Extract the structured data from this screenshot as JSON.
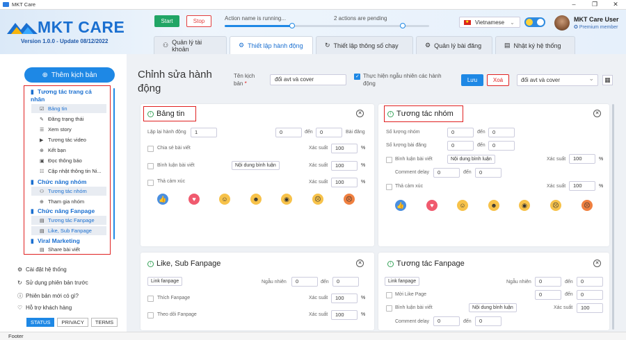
{
  "window": {
    "title": "MKT Care"
  },
  "brand": {
    "name": "MKT CARE",
    "version": "Version 1.0.0 - Update 08/12/2022"
  },
  "controls": {
    "start": "Start",
    "stop": "Stop",
    "action_status": "Action name is running...",
    "pending_status": "2 actions are pending",
    "action_progress": 0.33,
    "pending_progress": 0.72
  },
  "language": {
    "selected": "Vietnamese"
  },
  "user": {
    "name": "MKT Care User",
    "tier": "Premium member"
  },
  "tabs": [
    {
      "label": "Quản lý tài khoản",
      "icon": "user-icon"
    },
    {
      "label": "Thiết lập hành động",
      "icon": "gear-icon"
    },
    {
      "label": "Thiết lập thông số chạy",
      "icon": "refresh-icon"
    },
    {
      "label": "Quản lý bài đăng",
      "icon": "gear-icon"
    },
    {
      "label": "Nhật ký hệ thống",
      "icon": "log-icon"
    }
  ],
  "sidebar": {
    "add_button": "Thêm kịch bản",
    "groups": [
      {
        "label": "Tương tác trang cá",
        "label2": "nhân",
        "items": [
          "Bảng tin",
          "Đăng trạng thái",
          "Xem story",
          "Tương tác video",
          "Kết bạn",
          "Đọc thông báo",
          "Cập nhật thông tin Ni..."
        ]
      },
      {
        "label": "Chức năng nhóm",
        "items": [
          "Tương tác nhóm",
          "Tham gia nhóm"
        ]
      },
      {
        "label": "Chức năng Fanpage",
        "items": [
          "Tương tác Fanpage",
          "Like, Sub Fanpage"
        ]
      },
      {
        "label": "Viral Marketing",
        "items": [
          "Share bài viết"
        ]
      }
    ],
    "links": [
      "Cài đặt hệ thống",
      "Sử dụng phiên bản trước",
      "Phiên bản mới có gì?",
      "Hỗ trợ khách hàng"
    ],
    "footer_buttons": [
      "STATUS",
      "PRIVACY",
      "TERMS"
    ]
  },
  "footer": "Footer",
  "editor": {
    "title": "Chỉnh sửa hành động",
    "name_label": "Tên kịch bản",
    "required": "*",
    "name_value": "đổi avt và cover",
    "random_label": "Thực hiện ngẫu nhiên các hành động",
    "save": "Lưu",
    "delete": "Xoá",
    "select_value": "đổi avt và cover"
  },
  "cards": {
    "bang_tin": {
      "title": "Bảng tin",
      "repeat_label": "Lặp lại hành động",
      "repeat_value": "1",
      "from_value": "0",
      "to_label": "đến",
      "to_value": "0",
      "posts_label": "Bài đăng",
      "rows": [
        {
          "label": "Chia sẻ bài viết",
          "prob_label": "Xác suất",
          "value": "100",
          "unit": "%"
        },
        {
          "label": "Bình luận bài viết",
          "button": "Nội dung bình luận",
          "prob_label": "Xác suất",
          "value": "100",
          "unit": "%"
        },
        {
          "label": "Thả cảm xúc",
          "prob_label": "Xác suất",
          "value": "100",
          "unit": "%"
        }
      ]
    },
    "tuong_tac_nhom": {
      "title": "Tương tác nhóm",
      "groups_label": "Số lượng nhóm",
      "posts_label": "Số lượng bài đăng",
      "to_label": "đến",
      "g_from": "0",
      "g_to": "0",
      "p_from": "0",
      "p_to": "0",
      "comment_label": "Bình luận bài viết",
      "comment_button": "Nội dung bình luận",
      "prob_label": "Xác suất",
      "comment_value": "100",
      "unit": "%",
      "delay_label": "Comment delay",
      "delay_from": "0",
      "delay_to": "0",
      "react_label": "Thả cảm xúc",
      "react_value": "100"
    },
    "like_sub": {
      "title": "Like, Sub Fanpage",
      "link_button": "Link fanpage",
      "random_label": "Ngẫu nhiên",
      "from": "0",
      "to_label": "đến",
      "to": "0",
      "rows": [
        {
          "label": "Thích Fanpage",
          "prob_label": "Xác suất",
          "value": "100",
          "unit": "%"
        },
        {
          "label": "Theo dõi Fanpage",
          "prob_label": "Xác suất",
          "value": "100",
          "unit": "%"
        }
      ]
    },
    "tuong_tac_fanpage": {
      "title": "Tương tác Fanpage",
      "link_button": "Link fanpage",
      "random_label": "Ngẫu nhiên",
      "from": "0",
      "to_label": "đến",
      "to": "0",
      "like_label": "Mời Like Page",
      "like_from": "0",
      "like_to": "0",
      "comment_label": "Bình luận bài viết",
      "comment_button": "Nội dung bình luận",
      "prob_label": "Xác suất",
      "comment_value": "100",
      "delay_label": "Comment delay",
      "delay_from": "0",
      "delay_to": "0"
    }
  },
  "reactions": [
    "like-icon",
    "love-icon",
    "care-icon",
    "haha-icon",
    "wow-icon",
    "sad-icon",
    "angry-icon"
  ],
  "colors": {
    "accent": "#1e88e5",
    "start": "#20a565",
    "danger": "#e02020"
  }
}
